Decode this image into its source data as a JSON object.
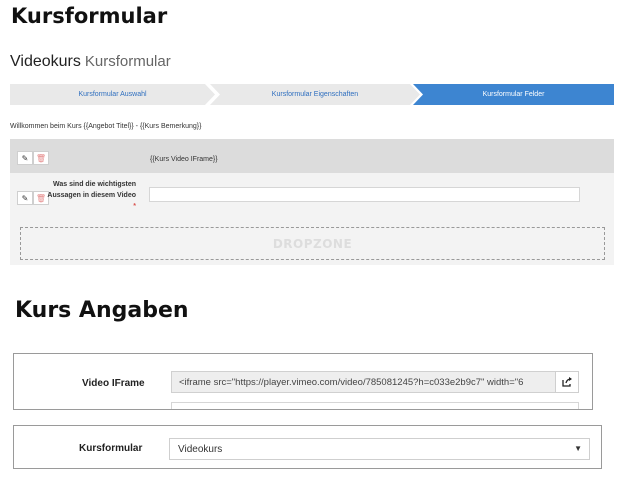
{
  "section1": {
    "title": "Kursformular"
  },
  "header": {
    "title": "Videokurs",
    "subtitle": "Kursformular"
  },
  "wizard": {
    "steps": [
      {
        "label": "Kursformular Auswahl",
        "active": false
      },
      {
        "label": "Kursformular Eigenschaften",
        "active": false
      },
      {
        "label": "Kursformular Felder",
        "active": true
      }
    ],
    "active_color": "#3d85d1"
  },
  "welcome": "Willkommen beim Kurs {{Angebot Titel}} - {{Kurs Bemerkung}}",
  "builder": {
    "row1": {
      "text": "{{Kurs Video IFrame}}"
    },
    "row2": {
      "label": "Was sind die wichtigsten Aussagen in diesem Video",
      "required_marker": "*",
      "value": ""
    },
    "dropzone": "DROPZONE",
    "icons": {
      "edit": "pencil-icon",
      "delete": "trash-icon"
    }
  },
  "section2": {
    "title": "Kurs Angaben"
  },
  "kurs_angaben": {
    "video_iframe": {
      "label": "Video IFrame",
      "value": "<iframe src=\"https://player.vimeo.com/video/785081245?h=c033e2b9c7\" width=\"6",
      "button_icon": "share-icon"
    },
    "kursformular": {
      "label": "Kursformular",
      "selected": "Videokurs"
    }
  }
}
